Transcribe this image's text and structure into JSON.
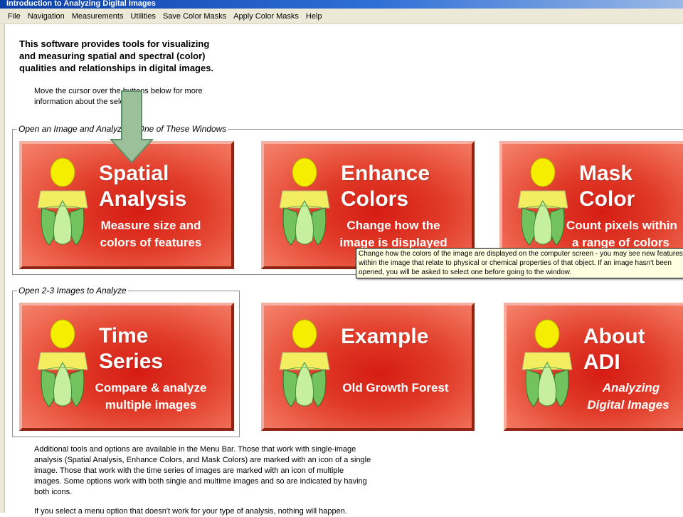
{
  "window": {
    "title": "Introduction to Analyzing Digital Images"
  },
  "menu": [
    "File",
    "Navigation",
    "Measurements",
    "Utilities",
    "Save Color Masks",
    "Apply Color Masks",
    "Help"
  ],
  "intro": {
    "line1": "This software provides tools for visualizing",
    "line2": "and measuring spatial and spectral (color)",
    "line3": "qualities and relationships in digital images."
  },
  "hint": {
    "line1": "Move the cursor over the buttons below for more",
    "line2": "information about the selection."
  },
  "group1": {
    "legend": "Open an Image and Analyze in One of These Windows",
    "buttons": [
      {
        "title1": "Spatial",
        "title2": "Analysis",
        "sub1": "Measure size and",
        "sub2": "colors of features"
      },
      {
        "title1": "Enhance",
        "title2": "Colors",
        "sub1": "Change how the",
        "sub2": "image is displayed"
      },
      {
        "title1": "Mask",
        "title2": "Color",
        "sub1": "Count pixels within",
        "sub2": "a range of colors"
      }
    ]
  },
  "group2": {
    "legend": "Open 2-3 Images to Analyze",
    "buttons": [
      {
        "title1": "Time",
        "title2": "Series",
        "sub1": "Compare & analyze",
        "sub2": "multiple images"
      },
      {
        "title1": "Example",
        "sub1": "Old Growth Forest"
      },
      {
        "title1": "About",
        "title2": "ADI",
        "sub1": "Analyzing",
        "sub2": "Digital Images"
      }
    ]
  },
  "tooltip": {
    "line1": "Change how the colors of the image are displayed on the computer screen - you may see new features",
    "line2": "within the image that relate to physical or chemical properties of that object.  If an image hasn't been",
    "line3": "opened, you will be asked to select one before going to the window."
  },
  "bottom": {
    "line1": "Additional tools and options are available in the Menu Bar.  Those that work with single-image",
    "line2": "analysis (Spatial Analysis, Enhance Colors, and Mask Colors) are marked with an icon of a single",
    "line3": "image.  Those that work with the time series of images are marked with an icon of multiple",
    "line4": "images.  Some options work with both single and multime images and so are indicated by having",
    "line5": "both icons.",
    "line6": "If you select a menu option that doesn't work for your type of analysis, nothing will happen."
  },
  "colors": {
    "button_red": "#d61c14",
    "button_light": "#f4816b",
    "titlebar_blue": "#0a3fa8",
    "arrow_green": "#9cc09a"
  },
  "icons": [
    "person-figure-icon",
    "down-arrow-icon"
  ]
}
